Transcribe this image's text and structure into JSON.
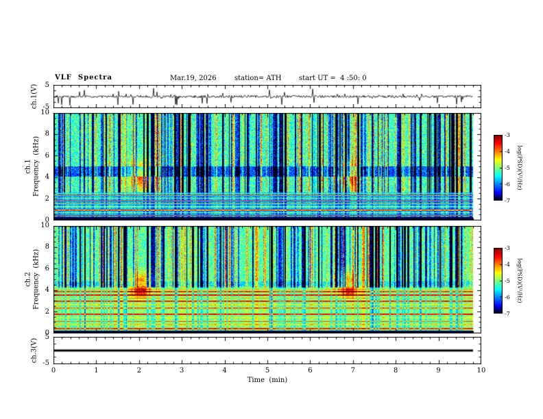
{
  "header": {
    "title": "VLF  Spectra",
    "date": "Mar.19, 2026",
    "station": "station= ATH",
    "start_ut": "start UT =  4 :50: 0"
  },
  "x_axis": {
    "label": "Time  (min)",
    "ticks": [
      "0",
      "1",
      "2",
      "3",
      "4",
      "5",
      "6",
      "7",
      "8",
      "9",
      "10"
    ]
  },
  "panels": {
    "ch1_wave": {
      "label": "ch.1(V)",
      "yticks": [
        "5",
        "-5"
      ]
    },
    "ch1_spec": {
      "label_line1": "ch.1",
      "label_line2": "Frequency  (kHz)",
      "yticks": [
        "10",
        "8",
        "6",
        "4",
        "2",
        "0"
      ]
    },
    "ch2_spec": {
      "label_line1": "ch.2",
      "label_line2": "Frequency  (kHz)",
      "yticks": [
        "10",
        "8",
        "6",
        "4",
        "2",
        "0"
      ]
    },
    "ch3_wave": {
      "label": "ch.3(V)",
      "yticks": [
        "5",
        "-5"
      ]
    }
  },
  "colorbar": {
    "label": "log(PSD)(V²/Hz)",
    "ticks": [
      "-3",
      "-4",
      "-5",
      "-6",
      "-7"
    ]
  },
  "colors": {
    "frame": "#000000",
    "background": "#ffffff",
    "colormap": "jet (dark blue/black = -7 low, cyan/green mid, yellow, red = -3 high)"
  },
  "chart_data": [
    {
      "type": "line",
      "panel": "ch.1(V) waveform",
      "xlabel": "Time (min)",
      "xlim": [
        0,
        10
      ],
      "ylim": [
        -5,
        5
      ],
      "description": "Broadband noisy voltage waveform centred on 0 V with frequent impulsive spikes of roughly +/-2 to +/-4 V over the whole 0-9.8 min record; drawn as a thin black trace."
    },
    {
      "type": "heatmap",
      "panel": "ch.1 spectrogram",
      "xlabel": "Time (min)",
      "ylabel": "Frequency (kHz)",
      "xlim": [
        0,
        10
      ],
      "ylim": [
        0,
        10
      ],
      "zlabel": "log(PSD)(V²/Hz)",
      "zlim": [
        -7,
        -3
      ],
      "colormap": "jet",
      "legend_position": "right colorbar with ticks -3 to -7",
      "features": [
        "background PSD about -5.5 to -5 (cyan/green mottle) above ~2.5 kHz",
        "dense vertical impulsive striations: dark-blue dropouts and yellow-green bursts spanning 2.5-10 kHz",
        "suppressed dark-blue horizontal band near 4-5 kHz",
        "stack of strong narrowband horizontal lines (red/yellow/green, PSD near -4 to -3.5) below ~2.6 kHz",
        "near-black band below ~0.3 kHz",
        "bright green enhancement blobs near t~2 min and t~6.8 min around 4 kHz",
        "data ends near t~9.8 min leaving a white gap before the right frame edge"
      ]
    },
    {
      "type": "heatmap",
      "panel": "ch.2 spectrogram",
      "xlabel": "Time (min)",
      "ylabel": "Frequency (kHz)",
      "xlim": [
        0,
        10
      ],
      "ylim": [
        0,
        10
      ],
      "zlabel": "log(PSD)(V²/Hz)",
      "zlim": [
        -7,
        -3
      ],
      "colormap": "jet",
      "legend_position": "right colorbar with ticks -3 to -7",
      "features": [
        "background PSD about -5 (green/cyan) above ~4.5 kHz with many vertical striations",
        "dense stack of strong horizontal narrowband lines (green/yellow/red) between ~0.3 and ~4.3 kHz",
        "bright yellow-orange enhancement blobs near t~2 min and t~6.8 min at ~4 kHz",
        "intermittent dashed red line near 3.6 kHz",
        "near-black band below ~0.3 kHz",
        "data ends near t~9.8 min leaving a white gap before the right frame edge"
      ]
    },
    {
      "type": "line",
      "panel": "ch.3(V) waveform",
      "xlabel": "Time (min)",
      "xlim": [
        0,
        10
      ],
      "ylim": [
        -5,
        5
      ],
      "description": "Perfectly flat thick black line at exactly 0 V for the whole record (channel inactive)."
    }
  ]
}
